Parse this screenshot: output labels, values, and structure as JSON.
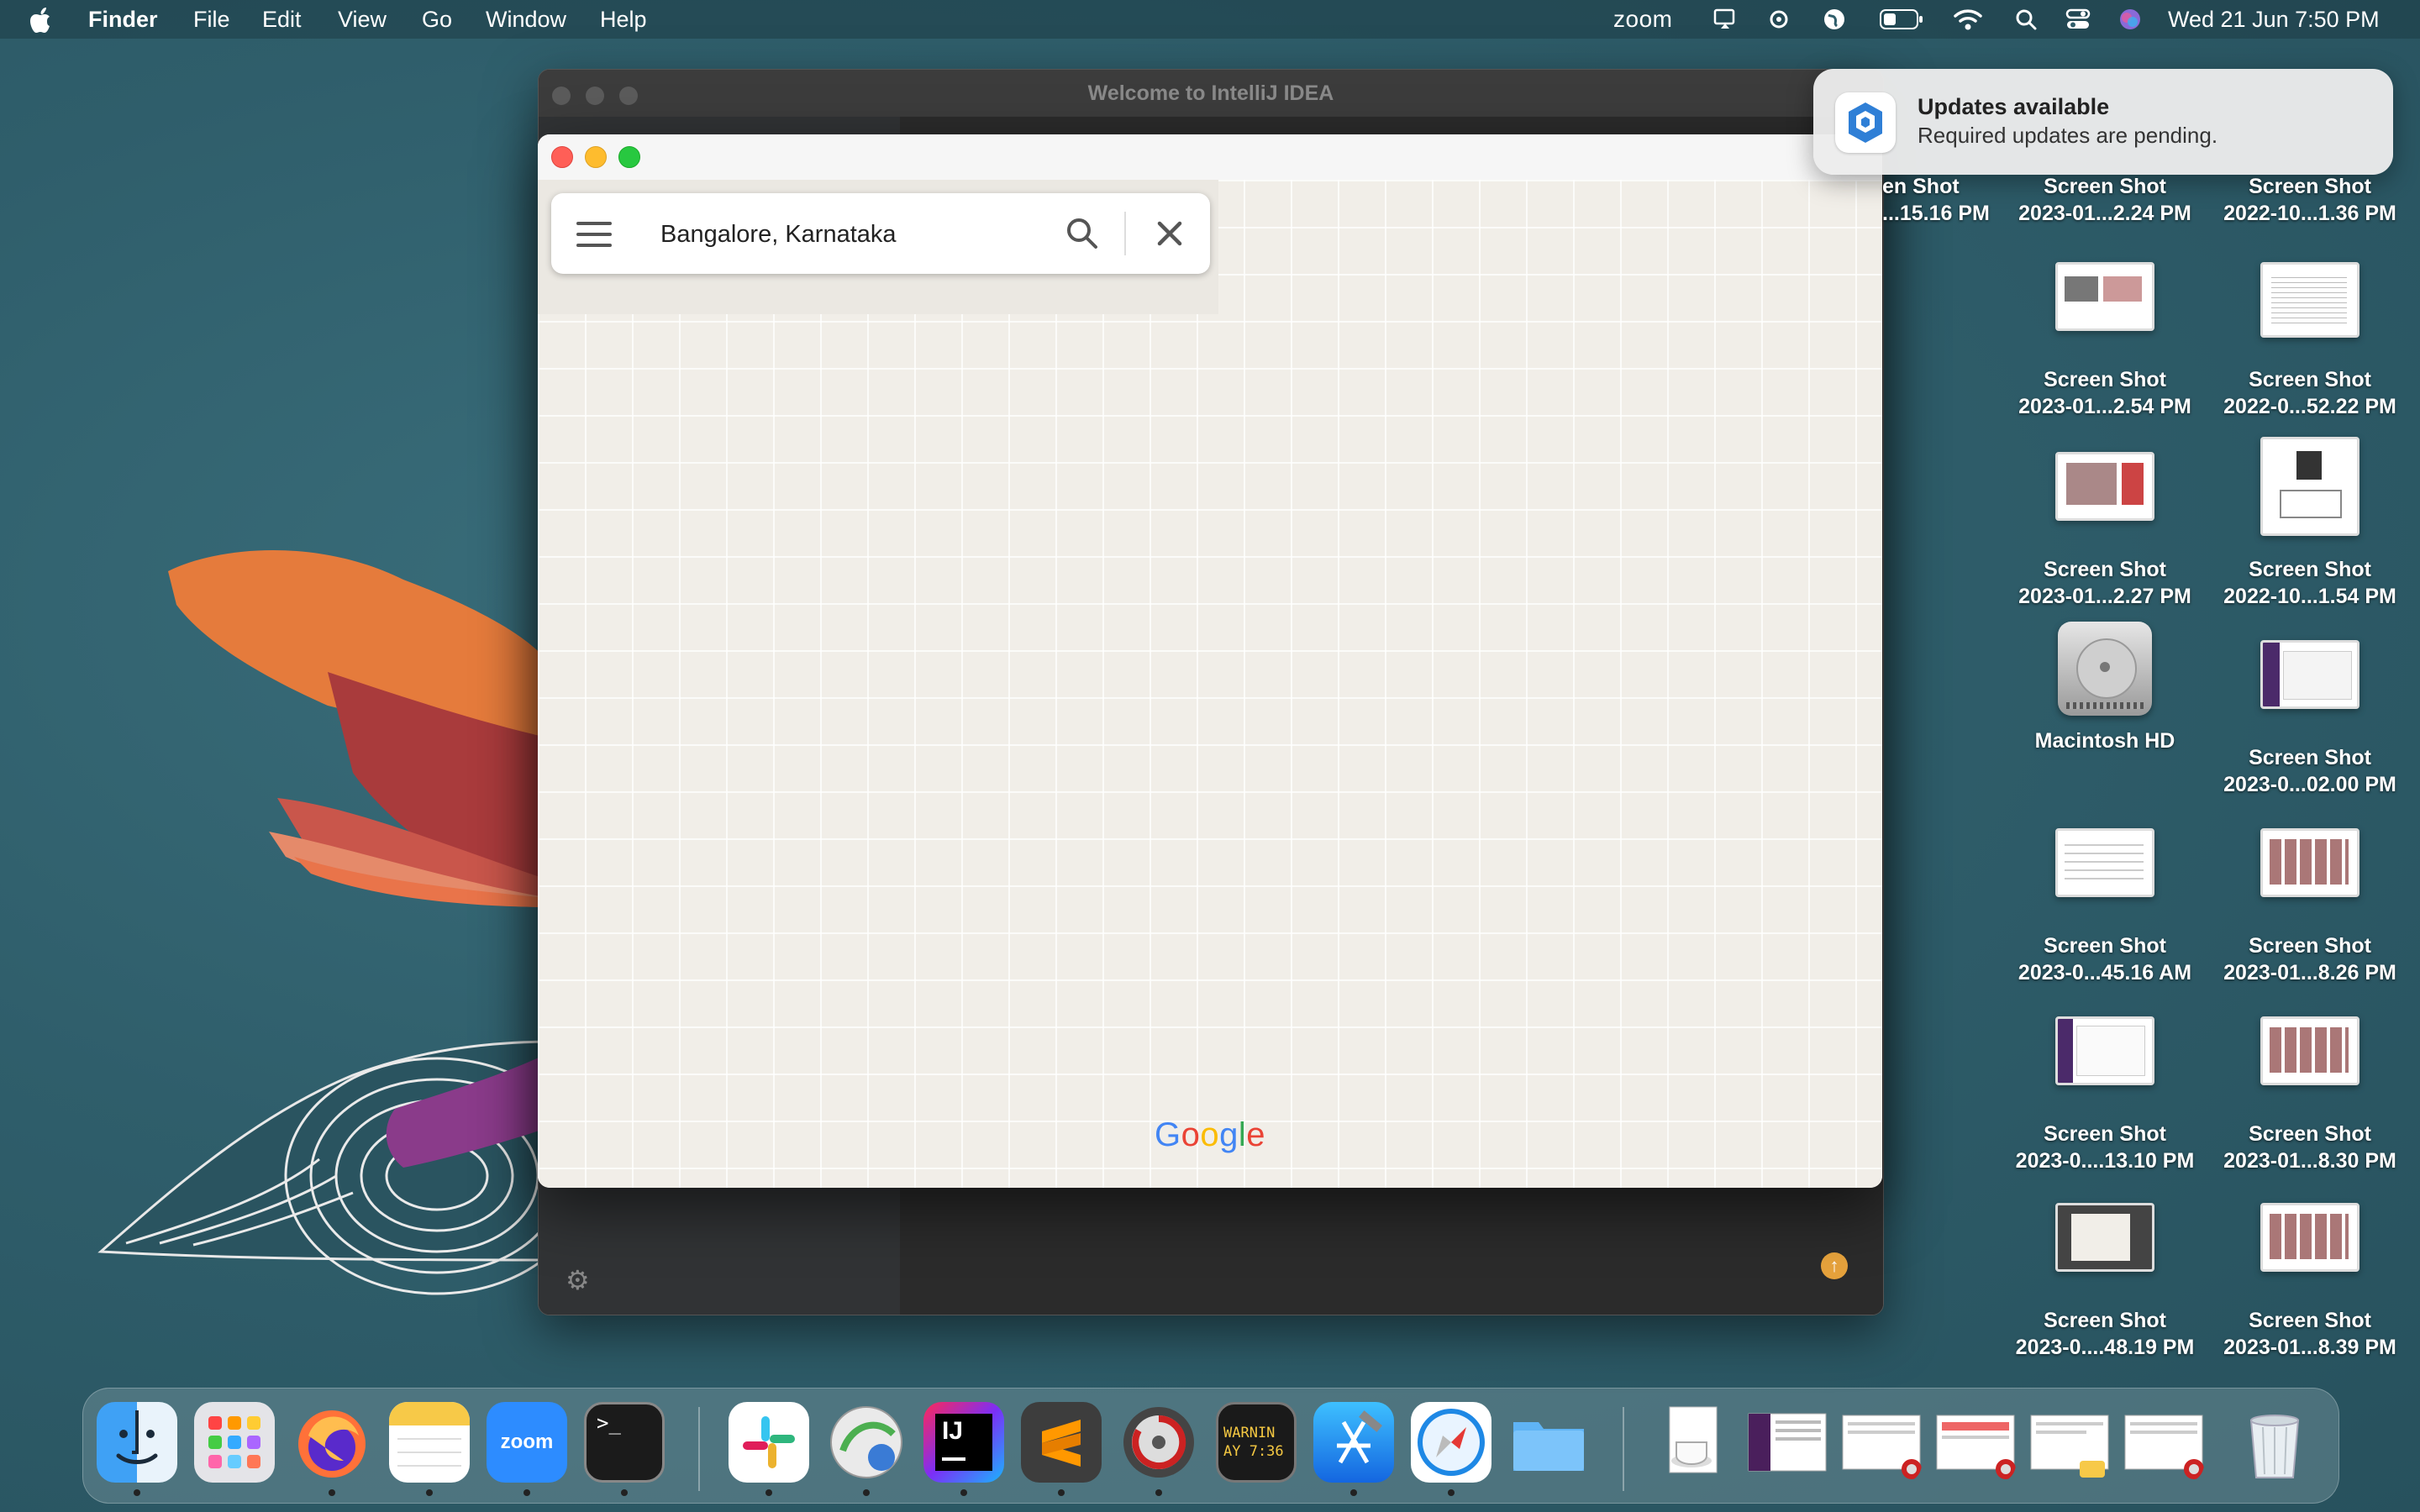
{
  "menubar": {
    "apple": "",
    "app_name": "Finder",
    "items": [
      "File",
      "Edit",
      "View",
      "Go",
      "Window",
      "Help"
    ],
    "status_zoom": "zoom",
    "clock": "Wed 21 Jun  7:50 PM"
  },
  "intellij": {
    "title": "Welcome to IntelliJ IDEA"
  },
  "map": {
    "search_value": "Bangalore, Karnataka",
    "logo": [
      "G",
      "o",
      "o",
      "g",
      "l",
      "e"
    ]
  },
  "notification": {
    "title": "Updates available",
    "body": "Required updates are pending."
  },
  "desktop_icons": [
    {
      "line1": "en Shot",
      "line2": "...15.16 PM"
    },
    {
      "line1": "Screen Shot",
      "line2": "2023-01...2.24 PM"
    },
    {
      "line1": "Screen Shot",
      "line2": "2022-10...1.36 PM"
    },
    {
      "line1": "Screen Shot",
      "line2": "2023-01...2.54 PM"
    },
    {
      "line1": "Screen Shot",
      "line2": "2022-0...52.22 PM"
    },
    {
      "line1": "Screen Shot",
      "line2": "2023-01...2.27 PM"
    },
    {
      "line1": "Screen Shot",
      "line2": "2022-10...1.54 PM"
    },
    {
      "line1": "Macintosh HD",
      "line2": ""
    },
    {
      "line1": "Screen Shot",
      "line2": "2023-0...02.00 PM"
    },
    {
      "line1": "Screen Shot",
      "line2": "2023-0...45.16 AM"
    },
    {
      "line1": "Screen Shot",
      "line2": "2023-01...8.26 PM"
    },
    {
      "line1": "Screen Shot",
      "line2": "2023-0....13.10 PM"
    },
    {
      "line1": "Screen Shot",
      "line2": "2023-01...8.30 PM"
    },
    {
      "line1": "Screen Shot",
      "line2": "2023-0....48.19 PM"
    },
    {
      "line1": "Screen Shot",
      "line2": "2023-01...8.39 PM"
    }
  ],
  "dock": {
    "zoom_label": "zoom",
    "intellij_label": "IJ",
    "console_line1": "WARNIN",
    "console_line2": "AY 7:36",
    "terminal_label": ">_"
  },
  "colors": {
    "google_blue": "#4285F4",
    "google_red": "#EA4335",
    "google_yellow": "#FBBC05",
    "google_green": "#34A853"
  }
}
